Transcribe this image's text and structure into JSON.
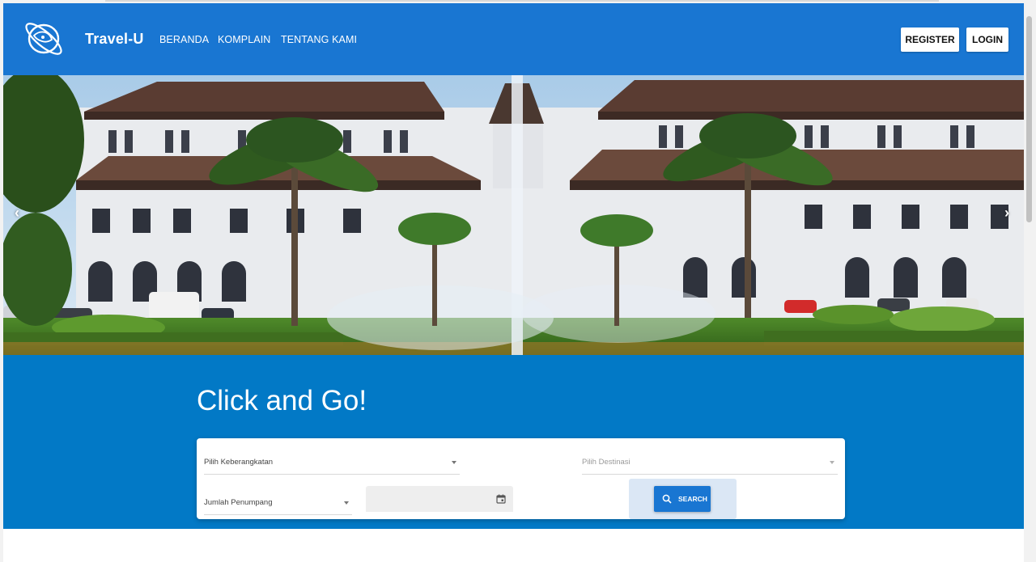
{
  "header": {
    "brand": "Travel-U",
    "nav": [
      "BERANDA",
      "KOMPLAIN",
      "TENTANG KAMI"
    ],
    "register_label": "REGISTER",
    "login_label": "LOGIN",
    "color": "#1976d2"
  },
  "hero": {
    "prev_icon": "‹",
    "next_icon": "›"
  },
  "search": {
    "headline": "Click and Go!",
    "departure_placeholder": "Pilih Keberangkatan",
    "destination_placeholder": "Pilih Destinasi",
    "passengers_placeholder": "Jumlah Penumpang",
    "date_value": "",
    "search_label": "SEARCH",
    "band_color": "#0279c6"
  }
}
